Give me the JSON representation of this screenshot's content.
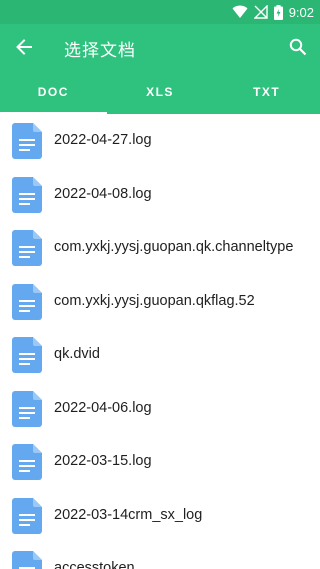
{
  "status_bar": {
    "time": "9:02",
    "icons": [
      "wifi-icon",
      "signal-off-icon",
      "battery-icon"
    ]
  },
  "app_bar": {
    "title": "选择文档",
    "back_icon": "arrow-left-icon",
    "search_icon": "search-icon"
  },
  "tabs": [
    {
      "label": "DOC",
      "selected": true
    },
    {
      "label": "XLS",
      "selected": false
    },
    {
      "label": "TXT",
      "selected": false
    }
  ],
  "files": [
    {
      "name": "2022-04-27.log"
    },
    {
      "name": "2022-04-08.log"
    },
    {
      "name": "com.yxkj.yysj.guopan.qk.channeltype"
    },
    {
      "name": "com.yxkj.yysj.guopan.qkflag.52"
    },
    {
      "name": "qk.dvid"
    },
    {
      "name": "2022-04-06.log"
    },
    {
      "name": "2022-03-15.log"
    },
    {
      "name": "2022-03-14crm_sx_log"
    },
    {
      "name": "accesstoken"
    }
  ],
  "colors": {
    "accent": "#2ec27e",
    "status_bar": "#2bb673",
    "doc_icon": "#64a8f0",
    "doc_icon_fold": "#9cc8f6"
  }
}
